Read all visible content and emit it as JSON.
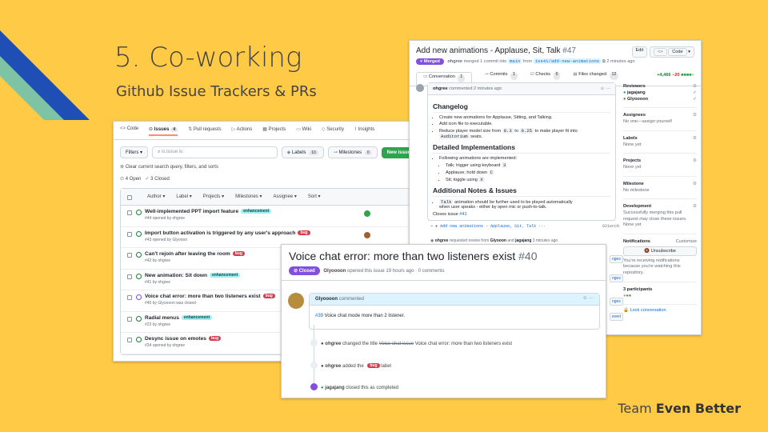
{
  "slide": {
    "title": "5. Co-working",
    "subtitle": "Github Issue Trackers & PRs",
    "team_prefix": "Team ",
    "team_name": "Even Better",
    "colors": {
      "background": "#ffcb47",
      "stripe_blue": "#1f4fb5",
      "stripe_green": "#7ec3a3"
    }
  },
  "issues_page": {
    "nav": [
      {
        "icon": "code-icon",
        "label": "Code"
      },
      {
        "icon": "issue-icon",
        "label": "Issues",
        "count": "4"
      },
      {
        "icon": "pull-request-icon",
        "label": "Pull requests"
      },
      {
        "icon": "play-icon",
        "label": "Actions"
      },
      {
        "icon": "table-icon",
        "label": "Projects"
      },
      {
        "icon": "book-icon",
        "label": "Wiki"
      },
      {
        "icon": "shield-icon",
        "label": "Security"
      },
      {
        "icon": "graph-icon",
        "label": "Insights"
      }
    ],
    "filters_label": "Filters",
    "search_value": "is:issue is:",
    "labels_label": "Labels",
    "labels_count": "10",
    "milestones_label": "Milestones",
    "milestones_count": "0",
    "new_issue_label": "New issue",
    "clear_text": "Clear current search query, filters, and sorts",
    "open_count": "4 Open",
    "closed_count": "3 Closed",
    "columns": [
      "Author",
      "Label",
      "Projects",
      "Milestones",
      "Assignee",
      "Sort"
    ],
    "rows": [
      {
        "title": "Well-implemented PPT import feature",
        "label": "enhancement",
        "label_type": "enh",
        "sub": "#44 opened by ohgree",
        "avatar": "#2da44e",
        "status": "open"
      },
      {
        "title": "Import button activation is triggered by any user's approach",
        "label": "bug",
        "label_type": "bug",
        "sub": "#43 opened by Glyooon",
        "avatar": "#a0622d",
        "status": "open"
      },
      {
        "title": "Can't rejoin after leaving the room",
        "label": "bug",
        "label_type": "bug",
        "sub": "#42 by ohgree",
        "avatar": "",
        "status": "open"
      },
      {
        "title": "New animation: Sit down",
        "label": "enhancement",
        "label_type": "enh",
        "sub": "#41 by ohgree",
        "avatar": "",
        "status": "open"
      },
      {
        "title": "Voice chat error: more than two listeners exist",
        "label": "bug",
        "label_type": "bug",
        "sub": "#40 by Glyoooon was closed",
        "avatar": "",
        "status": "closed"
      },
      {
        "title": "Radial menus",
        "label": "enhancement",
        "label_type": "enh",
        "sub": "#23 by ohgree",
        "avatar": "",
        "status": "open"
      },
      {
        "title": "Desync issue on emotes",
        "label": "bug",
        "label_type": "bug",
        "sub": "#34 opened by ohgree",
        "avatar": "",
        "status": "open"
      }
    ]
  },
  "pr_page": {
    "title": "Add new animations - Applause, Sit, Talk",
    "number": "#47",
    "edit_label": "Edit",
    "code_label": "Code",
    "merged_label": "Merged",
    "meta_user": "ohgree",
    "meta_text1": " merged 1 commit into ",
    "base_branch": "main",
    "meta_text2": " from ",
    "head_branch": "iss41/add-new-animations",
    "meta_time": " 2 minutes ago",
    "tabs": [
      {
        "label": "Conversation",
        "count": "1"
      },
      {
        "label": "Commits",
        "count": "1"
      },
      {
        "label": "Checks",
        "count": "0"
      },
      {
        "label": "Files changed",
        "count": "12"
      }
    ],
    "additions": "+4,466",
    "deletions": "−20",
    "comment_author": "ohgree",
    "comment_time": " commented 2 minutes ago",
    "changelog_heading": "Changelog",
    "changelog": [
      "Create new animations for Applause, Sitting, and Talking.",
      "Add icon file to executable."
    ],
    "scale_text1": "Reduce player model size from ",
    "scale_from": "0.3",
    "scale_text2": " to ",
    "scale_to": "0.25",
    "scale_text3": " to make player fit into",
    "scale_code": "Auditorium",
    "scale_text4": " seats.",
    "impl_heading": "Detailed Implementations",
    "impl_intro": "Following animations are implemented:",
    "impl_items": [
      {
        "text": "Talk; trigger using keyboard ",
        "key": "3"
      },
      {
        "text": "Applause; hold down ",
        "key": "C"
      },
      {
        "text": "Sit; toggle using ",
        "key": "X"
      }
    ],
    "notes_heading": "Additional Notes & Issues",
    "notes_code": "Talk",
    "notes_text": " animation should be further used to be played automatically",
    "notes_text2": "when user speaks - either by open mic or push-to-talk.",
    "closes_text": "Closes issue ",
    "closes_link": "#41",
    "commit_line": "Add new animations - Applause, Sit, Talk",
    "commit_sha": "621ecc0",
    "review_user": "ohgree",
    "review_text": " requested review from ",
    "review_from1": "Glyooon",
    "review_and": " and ",
    "review_from2": "jagajang",
    "review_time": " 3 minutes ago",
    "peek_labels": [
      "nges",
      "nges",
      "nges",
      "evert"
    ],
    "sidebar": {
      "reviewers_h": "Reviewers",
      "reviewers": [
        "jagajang",
        "Glyoooon"
      ],
      "assignees_h": "Assignees",
      "assignees_t": "No one—assign yourself",
      "labels_h": "Labels",
      "labels_t": "None yet",
      "projects_h": "Projects",
      "projects_t": "None yet",
      "milestone_h": "Milestone",
      "milestone_t": "No milestone",
      "development_h": "Development",
      "development_t": "Successfully merging this pull request may close these issues.",
      "development_t2": "None yet",
      "notif_h": "Notifications",
      "customize": "Customize",
      "unsubscribe": "Unsubscribe",
      "notif_t": "You're receiving notifications because you're watching this repository.",
      "participants": "3 participants",
      "lock": "Lock conversation"
    }
  },
  "voice_issue": {
    "title": "Voice chat error: more than two listeners exist",
    "number": "#40",
    "status": "Closed",
    "meta_user": "Glyoooon",
    "meta_text": " opened this issue 19 hours ago · 0 comments",
    "comment_author": "Glyoooon",
    "comment_text": " commented",
    "comment_link": "#39",
    "comment_body": " Voice chat mode more than 2 listener.",
    "events": [
      {
        "user": "ohgree",
        "pre": " changed the title ",
        "old": "Voice chat issue",
        "new": " Voice chat error: more than two listeners exist"
      },
      {
        "user": "ohgree",
        "pre": " added the ",
        "label": "bug",
        "post": " label"
      },
      {
        "user": "jagajang",
        "pre": " closed this as completed"
      }
    ]
  }
}
